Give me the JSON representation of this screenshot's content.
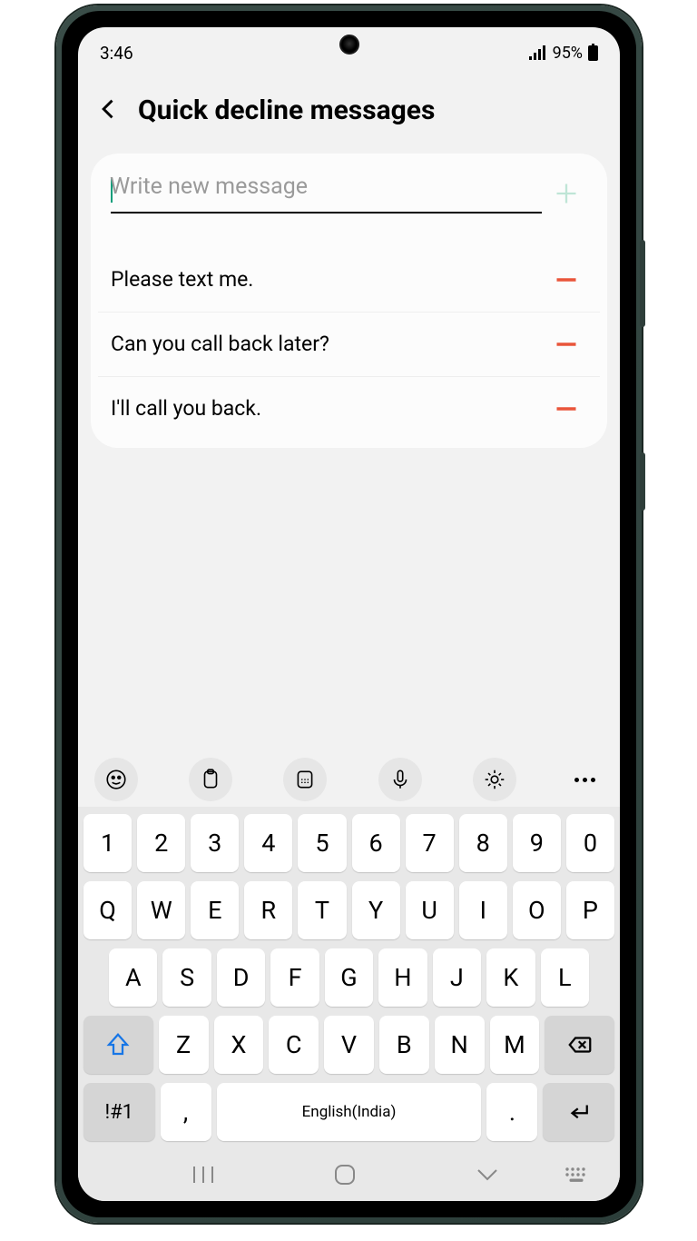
{
  "status": {
    "time": "3:46",
    "battery_pct": "95%"
  },
  "header": {
    "title": "Quick decline messages"
  },
  "input": {
    "placeholder": "Write new message"
  },
  "messages": [
    {
      "text": "Please text me."
    },
    {
      "text": "Can you call back later?"
    },
    {
      "text": "I'll call you back."
    }
  ],
  "keyboard": {
    "row1": [
      "1",
      "2",
      "3",
      "4",
      "5",
      "6",
      "7",
      "8",
      "9",
      "0"
    ],
    "row2": [
      "Q",
      "W",
      "E",
      "R",
      "T",
      "Y",
      "U",
      "I",
      "O",
      "P"
    ],
    "row3": [
      "A",
      "S",
      "D",
      "F",
      "G",
      "H",
      "J",
      "K",
      "L"
    ],
    "row4": [
      "Z",
      "X",
      "C",
      "V",
      "B",
      "N",
      "M"
    ],
    "sym": "!#1",
    "comma": ",",
    "space_label": "English(India)",
    "dot": "."
  }
}
